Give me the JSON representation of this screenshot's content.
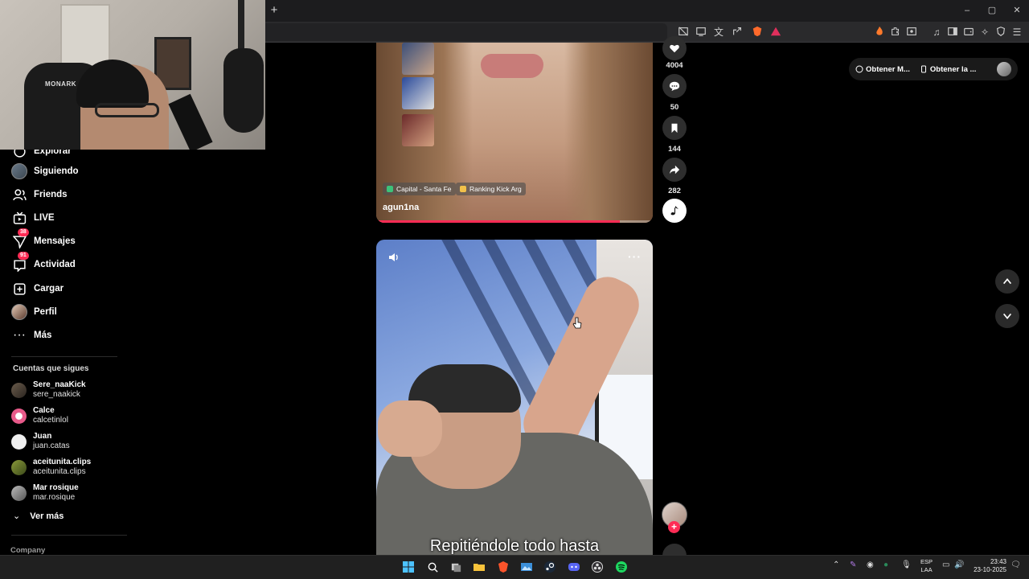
{
  "browser": {
    "new_tab": "+",
    "window_controls": [
      "–",
      "▢",
      "✕"
    ]
  },
  "webcam": {
    "chair_brand": "MONARK"
  },
  "sidebar": {
    "items": [
      {
        "label": "Explorar",
        "icon": "compass-icon"
      },
      {
        "label": "Siguiendo",
        "icon": "avatar-icon"
      },
      {
        "label": "Friends",
        "icon": "friends-icon"
      },
      {
        "label": "LIVE",
        "icon": "live-tv-icon"
      },
      {
        "label": "Mensajes",
        "icon": "messages-icon",
        "badge": "38"
      },
      {
        "label": "Actividad",
        "icon": "activity-icon",
        "badge": "91"
      },
      {
        "label": "Cargar",
        "icon": "upload-plus-icon"
      },
      {
        "label": "Perfil",
        "icon": "profile-avatar-icon"
      },
      {
        "label": "Más",
        "icon": "more-dots-icon"
      }
    ],
    "following_title": "Cuentas que sigues",
    "accounts": [
      {
        "name": "Sere_naaKick",
        "handle": "sere_naakick"
      },
      {
        "name": "Calce",
        "handle": "calcetinlol"
      },
      {
        "name": "Juan",
        "handle": "juan.catas"
      },
      {
        "name": "aceitunita.clips",
        "handle": "aceitunita.clips"
      },
      {
        "name": "Mar rosique",
        "handle": "mar.rosique"
      }
    ],
    "see_more": "Ver más",
    "company": "Company"
  },
  "video1": {
    "tags": [
      "Capital - Santa Fe",
      "Ranking Kick Arg"
    ],
    "author": "agun1na",
    "progress": 0.88,
    "actions": {
      "likes": "4004",
      "comments": "50",
      "saves": "144",
      "shares": "282"
    }
  },
  "video2": {
    "subtitle": "Repitiéndole todo hasta",
    "more": "···"
  },
  "top_pills": [
    "Obtener M...",
    "Obtener la ..."
  ],
  "taskbar": {
    "lang_line1": "ESP",
    "lang_line2": "LAA",
    "time": "23:43",
    "date": "23-10-2025"
  },
  "colors": {
    "accent": "#fe2c55",
    "background": "#000000"
  }
}
